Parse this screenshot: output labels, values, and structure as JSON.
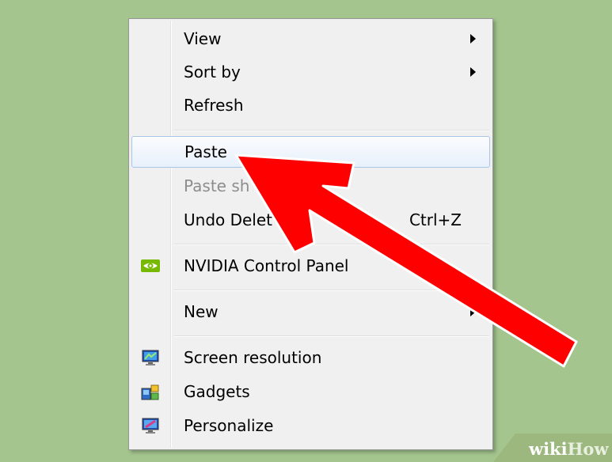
{
  "context_menu": {
    "items": [
      {
        "label": "View",
        "has_submenu": true
      },
      {
        "label": "Sort by",
        "has_submenu": true
      },
      {
        "label": "Refresh"
      },
      {
        "label": "Paste",
        "highlighted": true
      },
      {
        "label": "Paste sh",
        "disabled": true
      },
      {
        "label": "Undo Delet",
        "shortcut": "Ctrl+Z"
      },
      {
        "label": "NVIDIA Control Panel",
        "icon": "nvidia-eye-icon"
      },
      {
        "label": "New",
        "has_submenu": true
      },
      {
        "label": "Screen resolution",
        "icon": "monitor-icon"
      },
      {
        "label": "Gadgets",
        "icon": "gadgets-icon"
      },
      {
        "label": "Personalize",
        "icon": "personalize-icon"
      }
    ]
  },
  "overlay": {
    "arrow_color": "#ff0000",
    "arrow_outline": "#ffffff"
  },
  "watermark": {
    "part1": "wiki",
    "part2": "How"
  },
  "colors": {
    "desktop_background": "#a4c58e",
    "menu_background": "#f0f0f0",
    "highlight_border": "#a9c6e9"
  }
}
